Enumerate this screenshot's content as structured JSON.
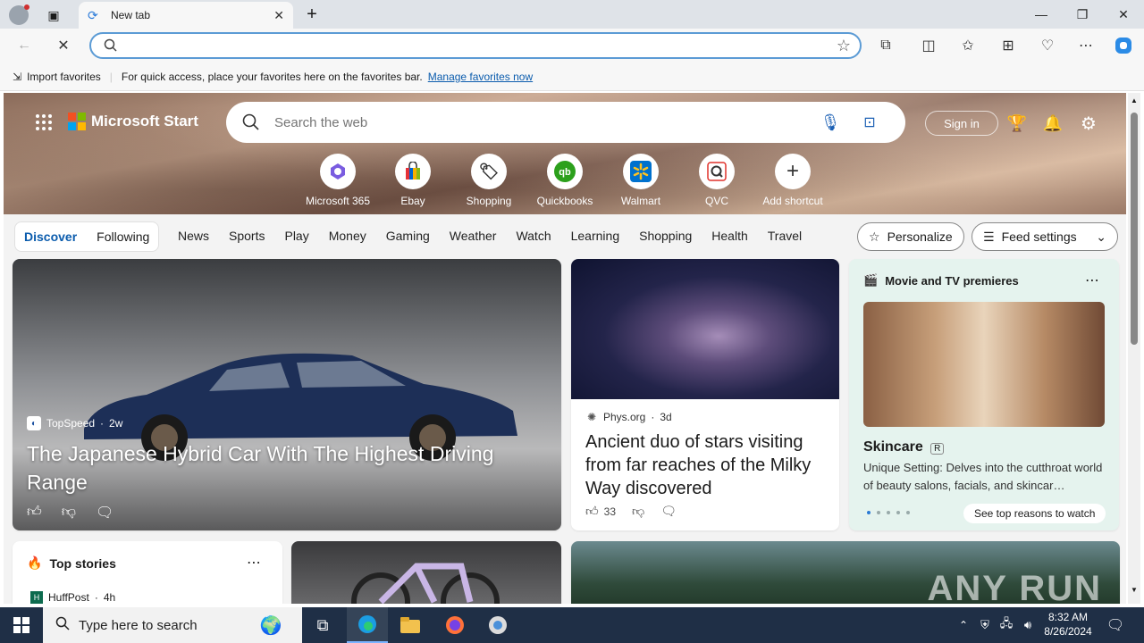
{
  "browser": {
    "tab_title": "New tab",
    "address_value": "",
    "fav_import": "Import favorites",
    "fav_message": "For quick access, place your favorites here on the favorites bar.",
    "fav_manage": "Manage favorites now"
  },
  "header": {
    "brand": "Microsoft Start",
    "search_placeholder": "Search the web",
    "signin": "Sign in"
  },
  "shortcuts": [
    {
      "label": "Microsoft 365"
    },
    {
      "label": "Ebay"
    },
    {
      "label": "Shopping"
    },
    {
      "label": "Quickbooks"
    },
    {
      "label": "Walmart"
    },
    {
      "label": "QVC"
    },
    {
      "label": "Add shortcut"
    }
  ],
  "feed_nav": {
    "discover": "Discover",
    "following": "Following",
    "items": [
      "News",
      "Sports",
      "Play",
      "Money",
      "Gaming",
      "Weather",
      "Watch",
      "Learning",
      "Shopping",
      "Health",
      "Travel"
    ],
    "personalize": "Personalize",
    "feed_settings": "Feed settings"
  },
  "cards": {
    "main": {
      "source": "TopSpeed",
      "age": "2w",
      "headline": "The Japanese Hybrid Car With The Highest Driving Range"
    },
    "space": {
      "source": "Phys.org",
      "age": "3d",
      "headline": "Ancient duo of stars visiting from far reaches of the Milky Way discovered",
      "likes": "33"
    },
    "movie": {
      "header": "Movie and TV premieres",
      "title": "Skincare",
      "rating_badge": "R",
      "desc": "Unique Setting: Delves into the cutthroat world of beauty salons, facials, and skincar…",
      "cta": "See top reasons to watch"
    },
    "top_stories": {
      "header": "Top stories",
      "source": "HuffPost",
      "age": "4h"
    }
  },
  "watermark": "ANY RUN",
  "taskbar": {
    "search_placeholder": "Type here to search",
    "time": "8:32 AM",
    "date": "8/26/2024"
  }
}
